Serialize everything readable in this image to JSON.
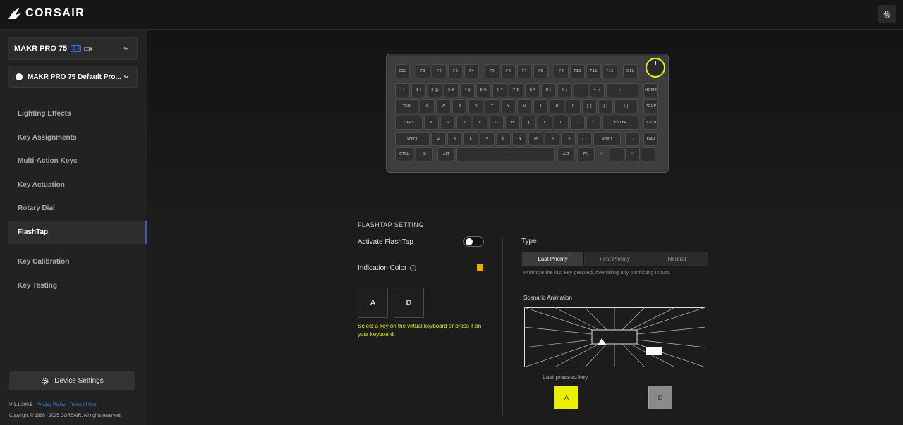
{
  "app": {
    "brand": "CORSAIR"
  },
  "device": {
    "name": "MAKR PRO 75",
    "connection_badge": "2.4"
  },
  "profile": {
    "name": "MAKR PRO 75 Default Pro..."
  },
  "nav": [
    {
      "label": "Lighting Effects",
      "active": false
    },
    {
      "label": "Key Assignments",
      "active": false
    },
    {
      "label": "Multi-Action Keys",
      "active": false
    },
    {
      "label": "Key Actuation",
      "active": false
    },
    {
      "label": "Rotary Dial",
      "active": false
    },
    {
      "label": "FlashTap",
      "active": true
    },
    {
      "label": "Key Calibration",
      "active": false
    },
    {
      "label": "Key Testing",
      "active": false
    }
  ],
  "footer": {
    "device_settings": "Device Settings",
    "version": "V 1.1.300.5",
    "privacy": "Privacy Policy",
    "terms": "Terms of Use",
    "copyright": "Copyright © 1996 - 2025 CORSAIR. All rights reserved."
  },
  "keyboard": {
    "rows": [
      [
        "ESC",
        "F1",
        "F2",
        "F3",
        "F4",
        "F5",
        "F6",
        "F7",
        "F8",
        "F9",
        "F10",
        "F11",
        "F12",
        "DEL"
      ],
      [
        "` ~",
        "1 !",
        "2 @",
        "3 #",
        "4 $",
        "5 %",
        "6 ^",
        "7 &",
        "8 *",
        "9 (",
        "0 )",
        "- _",
        "= +",
        "⟵",
        "HOME"
      ],
      [
        "TAB",
        "Q",
        "W",
        "E",
        "R",
        "T",
        "Y",
        "U",
        "I",
        "O",
        "P",
        "[ {",
        "] }",
        "\\ |",
        "PGUP"
      ],
      [
        "CAPS",
        "A",
        "S",
        "D",
        "F",
        "G",
        "H",
        "J",
        "K",
        "L",
        "; :",
        "' \"",
        "ENTER",
        "PGDN"
      ],
      [
        "SHIFT",
        "Z",
        "X",
        "C",
        "V",
        "B",
        "N",
        "M",
        ", <",
        ". >",
        "/ ?",
        "SHIFT",
        "︿",
        "END"
      ],
      [
        "CTRL",
        "⊞",
        "ALT",
        "—",
        "ALT",
        "FN",
        "⁝⁝",
        "‹",
        "﹀",
        "›"
      ]
    ]
  },
  "flashtap": {
    "section_title": "FLASHTAP SETTING",
    "activate_label": "Activate FlashTap",
    "activate_on": false,
    "indication_label": "Indication Color",
    "indication_color": "#f3a900",
    "key_a": "A",
    "key_d": "D",
    "hint": "Select a key on the virtual keyboard or press it on your keyboard."
  },
  "type": {
    "label": "Type",
    "options": [
      "Last Priority",
      "First Priority",
      "Neutral"
    ],
    "selected": "Last Priority",
    "description": "Prioritize the last key pressed, overriding any conflicting inputs."
  },
  "scenario": {
    "label": "Scenario Animation",
    "last_pressed_label": "Last pressed key",
    "key_a": "A",
    "key_d": "D"
  },
  "colors": {
    "accent": "#e8f000",
    "link": "#4c7fff",
    "active_marker": "#3c5dbf"
  }
}
